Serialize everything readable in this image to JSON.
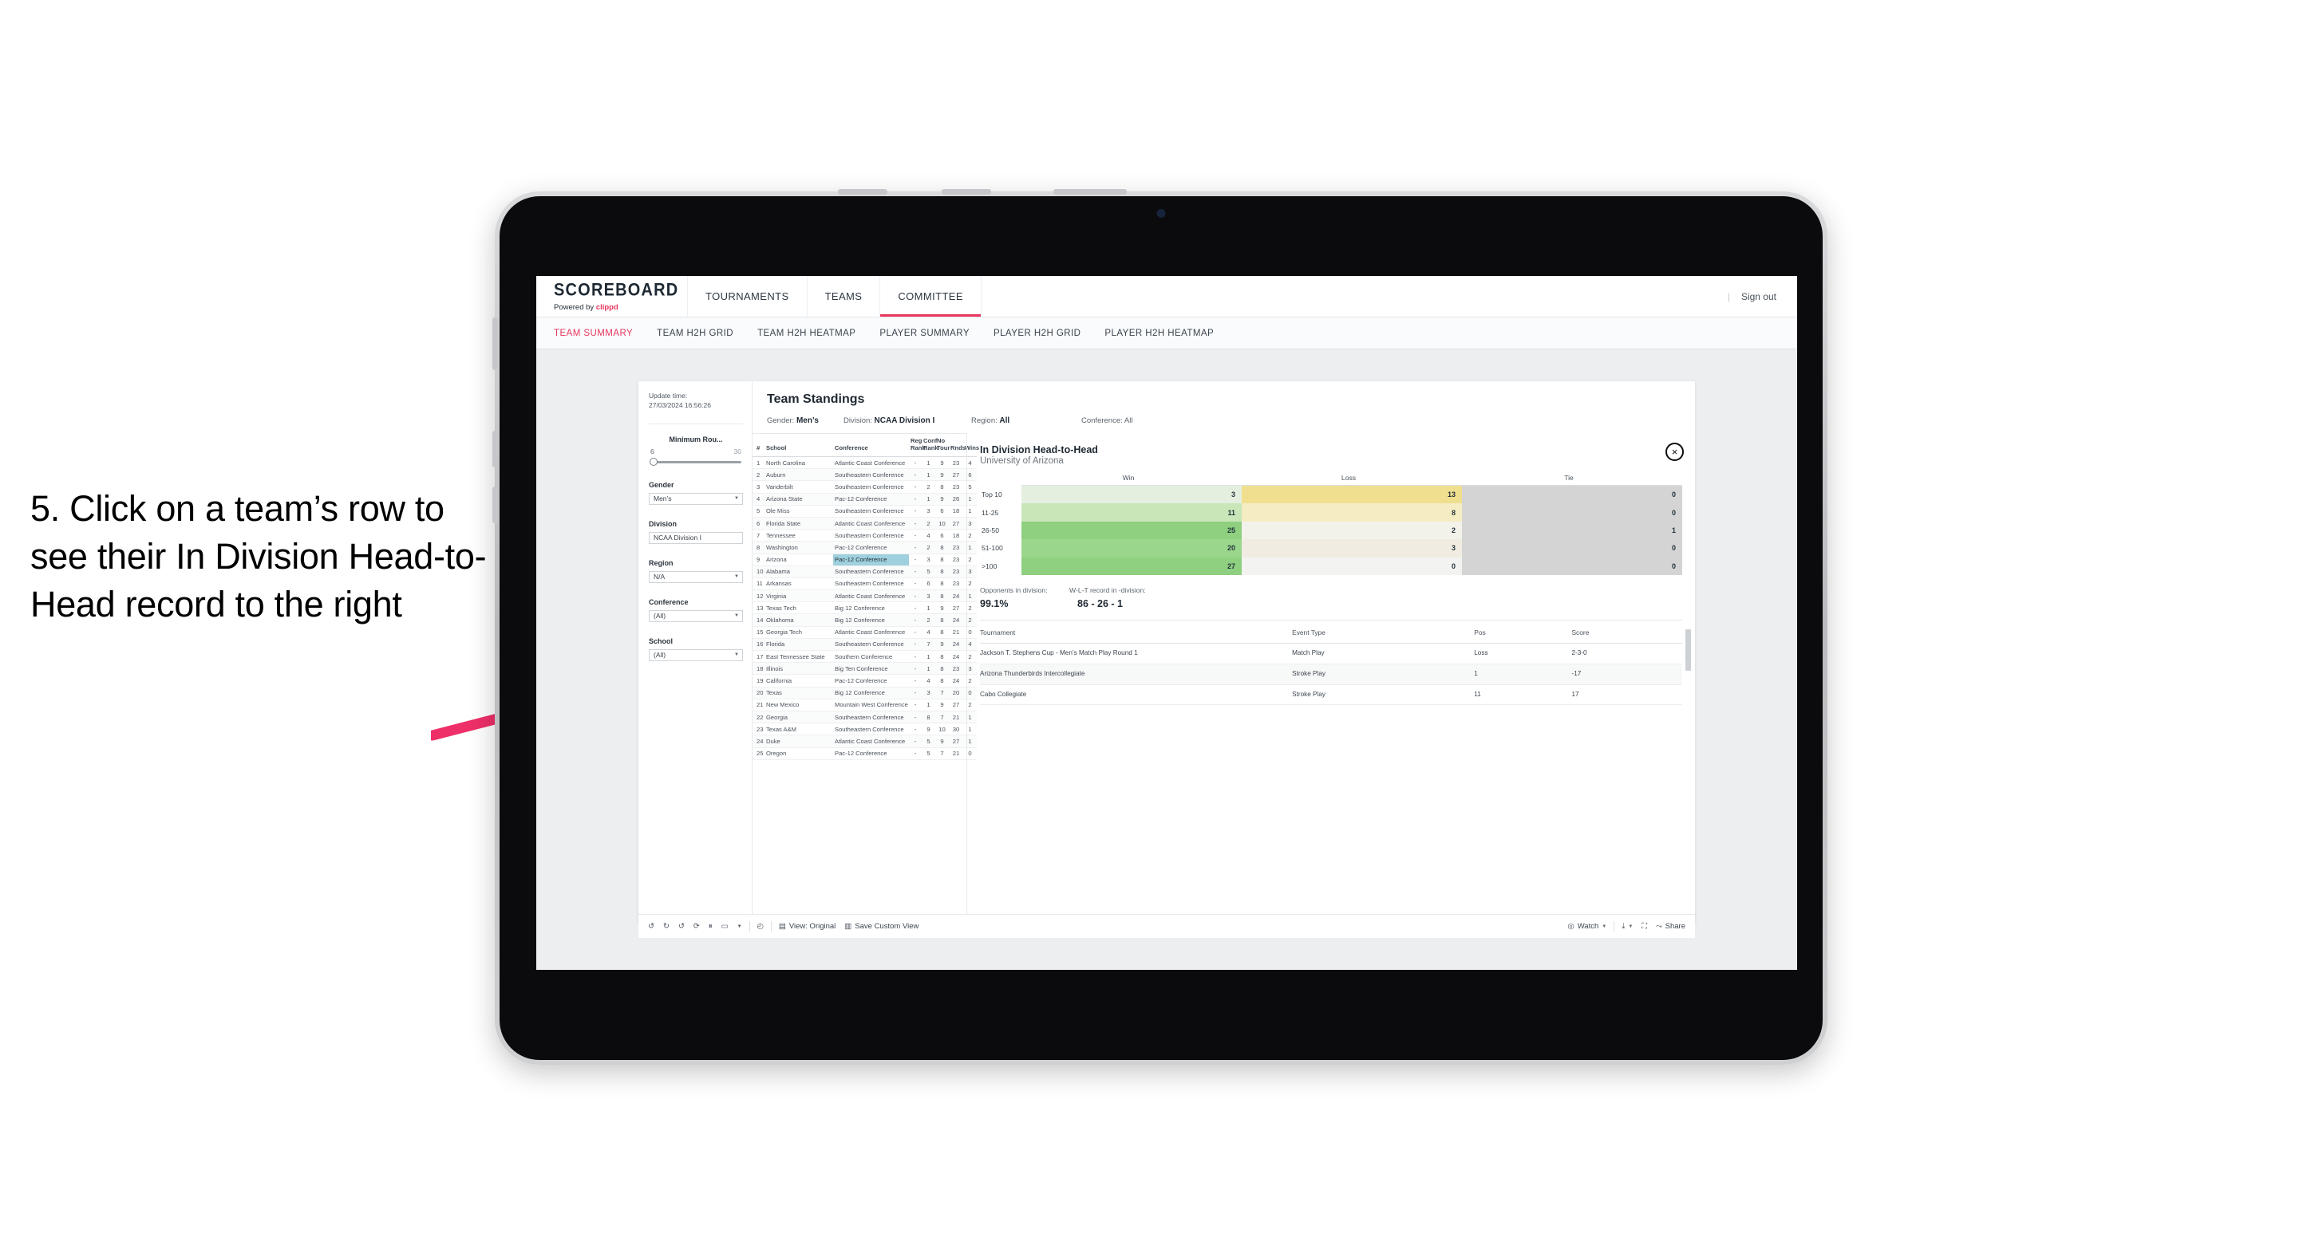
{
  "annotation": {
    "text": "5. Click on a team’s row to see their In Division Head-to-Head record to the right",
    "arrow_color": "#ee2f68"
  },
  "topnav": {
    "brand": {
      "title": "SCOREBOARD",
      "powered_prefix": "Powered by",
      "powered_brand": "clippd"
    },
    "items": [
      {
        "label": "TOURNAMENTS",
        "active": false
      },
      {
        "label": "TEAMS",
        "active": false
      },
      {
        "label": "COMMITTEE",
        "active": true
      }
    ],
    "divider": "|",
    "signout": "Sign out",
    "active_color": "#e8365d"
  },
  "subnav": {
    "items": [
      {
        "label": "TEAM SUMMARY",
        "active": true
      },
      {
        "label": "TEAM H2H GRID",
        "active": false
      },
      {
        "label": "TEAM H2H HEATMAP",
        "active": false
      },
      {
        "label": "PLAYER SUMMARY",
        "active": false
      },
      {
        "label": "PLAYER H2H GRID",
        "active": false
      },
      {
        "label": "PLAYER H2H HEATMAP",
        "active": false
      }
    ]
  },
  "sidebar": {
    "update_label": "Update time:",
    "update_value": "27/03/2024 16:56:26",
    "slider": {
      "title": "Minimum Rou...",
      "min": "6",
      "max": "30",
      "value_pct": 4
    },
    "filters": [
      {
        "title": "Gender",
        "value": "Men’s"
      },
      {
        "title": "Division",
        "value": "NCAA Division I"
      },
      {
        "title": "Region",
        "value": "N/A"
      },
      {
        "title": "Conference",
        "value": "(All)"
      },
      {
        "title": "School",
        "value": "(All)"
      }
    ]
  },
  "main": {
    "title": "Team Standings",
    "filters": [
      {
        "label": "Gender:",
        "value": "Men’s"
      },
      {
        "label": "Division:",
        "value": "NCAA Division I"
      },
      {
        "label": "Region:",
        "value": "All"
      },
      {
        "label": "Conference:",
        "value": "All"
      }
    ],
    "table": {
      "columns": [
        "#",
        "School",
        "Conference",
        "Reg Rank",
        "Conf Rank",
        "No Tour",
        "Rnds",
        "Wins"
      ],
      "selected_row_index": 8,
      "selected_highlight_color": "#9fd0dd",
      "rows": [
        {
          "num": "1",
          "school": "North Carolina",
          "conference": "Atlantic Coast Conference",
          "reg_rank": "-",
          "conf_rank": "1",
          "no_tour": "9",
          "rnds": "23",
          "wins": "4"
        },
        {
          "num": "2",
          "school": "Auburn",
          "conference": "Southeastern Conference",
          "reg_rank": "-",
          "conf_rank": "1",
          "no_tour": "9",
          "rnds": "27",
          "wins": "6"
        },
        {
          "num": "3",
          "school": "Vanderbilt",
          "conference": "Southeastern Conference",
          "reg_rank": "-",
          "conf_rank": "2",
          "no_tour": "8",
          "rnds": "23",
          "wins": "5"
        },
        {
          "num": "4",
          "school": "Arizona State",
          "conference": "Pac-12 Conference",
          "reg_rank": "-",
          "conf_rank": "1",
          "no_tour": "9",
          "rnds": "26",
          "wins": "1"
        },
        {
          "num": "5",
          "school": "Ole Miss",
          "conference": "Southeastern Conference",
          "reg_rank": "-",
          "conf_rank": "3",
          "no_tour": "6",
          "rnds": "18",
          "wins": "1"
        },
        {
          "num": "6",
          "school": "Florida State",
          "conference": "Atlantic Coast Conference",
          "reg_rank": "-",
          "conf_rank": "2",
          "no_tour": "10",
          "rnds": "27",
          "wins": "3"
        },
        {
          "num": "7",
          "school": "Tennessee",
          "conference": "Southeastern Conference",
          "reg_rank": "-",
          "conf_rank": "4",
          "no_tour": "6",
          "rnds": "18",
          "wins": "2"
        },
        {
          "num": "8",
          "school": "Washington",
          "conference": "Pac-12 Conference",
          "reg_rank": "-",
          "conf_rank": "2",
          "no_tour": "8",
          "rnds": "23",
          "wins": "1"
        },
        {
          "num": "9",
          "school": "Arizona",
          "conference": "Pac-12 Conference",
          "reg_rank": "-",
          "conf_rank": "3",
          "no_tour": "8",
          "rnds": "23",
          "wins": "2"
        },
        {
          "num": "10",
          "school": "Alabama",
          "conference": "Southeastern Conference",
          "reg_rank": "-",
          "conf_rank": "5",
          "no_tour": "8",
          "rnds": "23",
          "wins": "3"
        },
        {
          "num": "11",
          "school": "Arkansas",
          "conference": "Southeastern Conference",
          "reg_rank": "-",
          "conf_rank": "6",
          "no_tour": "8",
          "rnds": "23",
          "wins": "2"
        },
        {
          "num": "12",
          "school": "Virginia",
          "conference": "Atlantic Coast Conference",
          "reg_rank": "-",
          "conf_rank": "3",
          "no_tour": "8",
          "rnds": "24",
          "wins": "1"
        },
        {
          "num": "13",
          "school": "Texas Tech",
          "conference": "Big 12 Conference",
          "reg_rank": "-",
          "conf_rank": "1",
          "no_tour": "9",
          "rnds": "27",
          "wins": "2"
        },
        {
          "num": "14",
          "school": "Oklahoma",
          "conference": "Big 12 Conference",
          "reg_rank": "-",
          "conf_rank": "2",
          "no_tour": "8",
          "rnds": "24",
          "wins": "2"
        },
        {
          "num": "15",
          "school": "Georgia Tech",
          "conference": "Atlantic Coast Conference",
          "reg_rank": "-",
          "conf_rank": "4",
          "no_tour": "8",
          "rnds": "21",
          "wins": "0"
        },
        {
          "num": "16",
          "school": "Florida",
          "conference": "Southeastern Conference",
          "reg_rank": "-",
          "conf_rank": "7",
          "no_tour": "9",
          "rnds": "24",
          "wins": "4"
        },
        {
          "num": "17",
          "school": "East Tennessee State",
          "conference": "Southern Conference",
          "reg_rank": "-",
          "conf_rank": "1",
          "no_tour": "8",
          "rnds": "24",
          "wins": "2"
        },
        {
          "num": "18",
          "school": "Illinois",
          "conference": "Big Ten Conference",
          "reg_rank": "-",
          "conf_rank": "1",
          "no_tour": "8",
          "rnds": "23",
          "wins": "3"
        },
        {
          "num": "19",
          "school": "California",
          "conference": "Pac-12 Conference",
          "reg_rank": "-",
          "conf_rank": "4",
          "no_tour": "8",
          "rnds": "24",
          "wins": "2"
        },
        {
          "num": "20",
          "school": "Texas",
          "conference": "Big 12 Conference",
          "reg_rank": "-",
          "conf_rank": "3",
          "no_tour": "7",
          "rnds": "20",
          "wins": "0"
        },
        {
          "num": "21",
          "school": "New Mexico",
          "conference": "Mountain West Conference",
          "reg_rank": "-",
          "conf_rank": "1",
          "no_tour": "9",
          "rnds": "27",
          "wins": "2"
        },
        {
          "num": "22",
          "school": "Georgia",
          "conference": "Southeastern Conference",
          "reg_rank": "-",
          "conf_rank": "8",
          "no_tour": "7",
          "rnds": "21",
          "wins": "1"
        },
        {
          "num": "23",
          "school": "Texas A&M",
          "conference": "Southeastern Conference",
          "reg_rank": "-",
          "conf_rank": "9",
          "no_tour": "10",
          "rnds": "30",
          "wins": "1"
        },
        {
          "num": "24",
          "school": "Duke",
          "conference": "Atlantic Coast Conference",
          "reg_rank": "-",
          "conf_rank": "5",
          "no_tour": "9",
          "rnds": "27",
          "wins": "1"
        },
        {
          "num": "25",
          "school": "Oregon",
          "conference": "Pac-12 Conference",
          "reg_rank": "-",
          "conf_rank": "5",
          "no_tour": "7",
          "rnds": "21",
          "wins": "0"
        }
      ]
    }
  },
  "h2h": {
    "title": "In Division Head-to-Head",
    "subtitle": "University of Arizona",
    "close_icon": "×",
    "matrix": {
      "columns": [
        "Win",
        "Loss",
        "Tie"
      ],
      "rows": [
        {
          "band": "Top 10",
          "win": "3",
          "loss": "13",
          "tie": "0",
          "win_color": "#e4efe0",
          "loss_color": "#efdf8e",
          "tie_color": "#d4d4d4"
        },
        {
          "band": "11-25",
          "win": "11",
          "loss": "8",
          "tie": "0",
          "win_color": "#c9e6b9",
          "loss_color": "#f5ecc4",
          "tie_color": "#d4d4d4"
        },
        {
          "band": "26-50",
          "win": "25",
          "loss": "2",
          "tie": "1",
          "win_color": "#8ed080",
          "loss_color": "#f3f2ea",
          "tie_color": "#d4d4d4"
        },
        {
          "band": "51-100",
          "win": "20",
          "loss": "3",
          "tie": "0",
          "win_color": "#9ad78c",
          "loss_color": "#f1ece1",
          "tie_color": "#d4d4d4"
        },
        {
          "band": ">100",
          "win": "27",
          "loss": "0",
          "tie": "0",
          "win_color": "#8ed080",
          "loss_color": "#f3f3f1",
          "tie_color": "#d4d4d4"
        }
      ]
    },
    "kpis": [
      {
        "label": "Opponents in division:",
        "value": "99.1%"
      },
      {
        "label": "W-L-T record in -division:",
        "value": "86 - 26 - 1"
      }
    ],
    "tournaments": {
      "columns": [
        "Tournament",
        "Event Type",
        "Pos",
        "Score"
      ],
      "rows": [
        {
          "name": "Jackson T. Stephens Cup - Men’s Match Play Round 1",
          "type": "Match Play",
          "pos": "Loss",
          "score": "2-3-0"
        },
        {
          "name": "Arizona Thunderbirds Intercollegiate",
          "type": "Stroke Play",
          "pos": "1",
          "score": "-17"
        },
        {
          "name": "Cabo Collegiate",
          "type": "Stroke Play",
          "pos": "11",
          "score": "17"
        }
      ]
    }
  },
  "toolbar": {
    "left_icons": [
      "undo-icon",
      "redo-icon",
      "revert-icon",
      "refresh-icon",
      "pause-icon",
      "rect-select-icon",
      "caret-down-icon"
    ],
    "history_icon": "history-icon",
    "view_label": "View: Original",
    "save_label": "Save Custom View",
    "watch_label": "Watch",
    "share_label": "Share",
    "download_icon": "download-icon",
    "fullscreen_icon": "fullscreen-icon"
  }
}
